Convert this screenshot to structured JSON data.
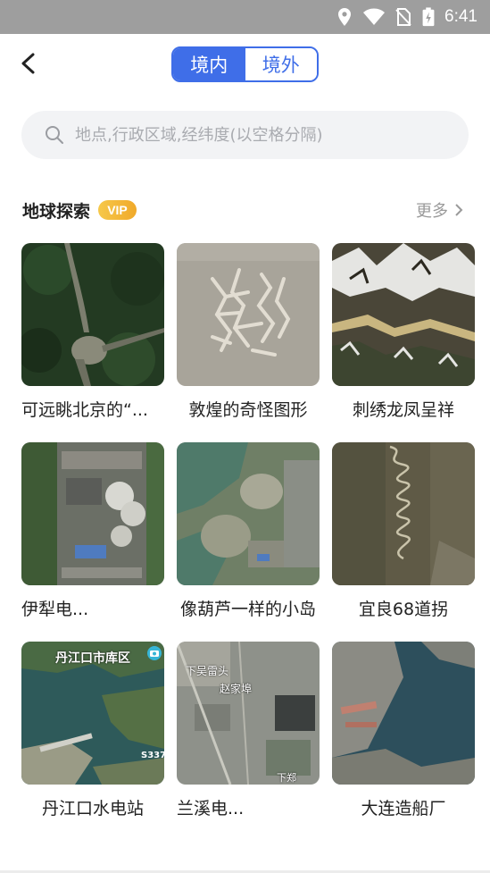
{
  "status_bar": {
    "time": "6:41"
  },
  "header": {
    "tabs": [
      {
        "label": "境内",
        "active": true
      },
      {
        "label": "境外",
        "active": false
      }
    ]
  },
  "search": {
    "placeholder": "地点,行政区域,经纬度(以空格分隔)"
  },
  "section": {
    "title": "地球探索",
    "badge": "VIP",
    "more_label": "更多"
  },
  "items": [
    {
      "caption": "可远眺北京的“...",
      "image": "forest-road"
    },
    {
      "caption": "敦煌的奇怪图形",
      "image": "desert-pattern"
    },
    {
      "caption": "刺绣龙凤呈祥",
      "image": "snowy-mountains"
    },
    {
      "caption": "伊犁电...",
      "image": "power-plant"
    },
    {
      "caption": "像葫芦一样的小岛",
      "image": "gourd-island"
    },
    {
      "caption": "宜良68道拐",
      "image": "winding-road"
    },
    {
      "caption": "丹江口水电站",
      "image": "dam-reservoir",
      "map_label": "丹江口市库区",
      "road_label": "S337"
    },
    {
      "caption": "兰溪电...",
      "image": "city-plant",
      "map_label_1": "下吴雷头",
      "map_label_2": "赵家埠",
      "map_label_3": "下郑"
    },
    {
      "caption": "大连造船厂",
      "image": "shipyard"
    }
  ],
  "colors": {
    "accent": "#3f6ee8",
    "vip": "#f0a92a",
    "statusbar": "#9e9e9e"
  }
}
